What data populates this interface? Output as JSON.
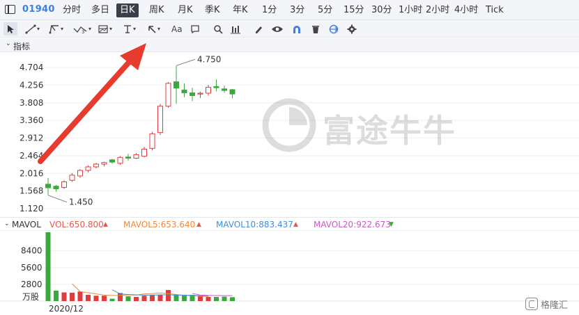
{
  "tabbar": {
    "code": "01940",
    "tabs": [
      "分时",
      "多日",
      "日K",
      "周K",
      "月K",
      "季K",
      "年K",
      "1分",
      "3分",
      "5分",
      "15分",
      "30分",
      "1小时",
      "2小时",
      "4小时",
      "Tick"
    ],
    "active": "日K"
  },
  "toolbar": {
    "tools": [
      "cursor-icon",
      "line-tool-icon",
      "pitchfork-tool-icon",
      "wave-tool-icon",
      "fib-grid-icon",
      "price-range-icon",
      "arrow-tool-icon",
      "text-tool-icon",
      "note-tool-icon",
      "zoom-icon",
      "chart-add-icon",
      "pen-icon",
      "eye-icon",
      "magnet-icon",
      "trash-icon",
      "sync-icon",
      "settings-icon"
    ],
    "text_tool_label": "Aa"
  },
  "indicator": {
    "label": "指标"
  },
  "price_axis": {
    "ticks": [
      "4.704",
      "4.256",
      "3.808",
      "3.360",
      "2.912",
      "2.464",
      "2.016",
      "1.568",
      "1.120"
    ],
    "high_label": "4.750",
    "low_label": "1.450"
  },
  "volume": {
    "title": "MAVOL",
    "vol_label": "VOL:650.800",
    "vol_arrow": "▲",
    "mavol5_label": "MAVOL5:653.640",
    "mavol5_arrow": "▲",
    "mavol10_label": "MAVOL10:883.437",
    "mavol10_arrow": "▲",
    "mavol20_label": "MAVOL20:922.673",
    "mavol20_arrow": "▼",
    "ticks": [
      "8400",
      "5600",
      "2800"
    ],
    "unit": "万股",
    "date_label": "2020/12"
  },
  "colors": {
    "up": "#e03c3c",
    "down": "#3aa83a",
    "accent": "#3f7fe0",
    "vol": "#e05a4a",
    "mavol5": "#f0883a",
    "mavol10": "#3c8fe0",
    "mavol20": "#cc55cc",
    "annotation_arrow": "#e63b2e"
  },
  "chart_data": {
    "type": "candlestick",
    "ylim": [
      1.12,
      4.75
    ],
    "candles": [
      {
        "o": 1.74,
        "c": 1.65,
        "h": 1.9,
        "l": 1.46
      },
      {
        "o": 1.69,
        "c": 1.62,
        "h": 1.72,
        "l": 1.55
      },
      {
        "o": 1.66,
        "c": 1.8,
        "h": 1.84,
        "l": 1.62
      },
      {
        "o": 1.84,
        "c": 1.97,
        "h": 2.02,
        "l": 1.8
      },
      {
        "o": 1.95,
        "c": 2.09,
        "h": 2.12,
        "l": 1.9
      },
      {
        "o": 2.09,
        "c": 2.18,
        "h": 2.22,
        "l": 2.04
      },
      {
        "o": 2.18,
        "c": 2.25,
        "h": 2.28,
        "l": 2.14
      },
      {
        "o": 2.25,
        "c": 2.29,
        "h": 2.31,
        "l": 2.19
      },
      {
        "o": 2.36,
        "c": 2.3,
        "h": 2.38,
        "l": 2.26
      },
      {
        "o": 2.27,
        "c": 2.42,
        "h": 2.45,
        "l": 2.23
      },
      {
        "o": 2.43,
        "c": 2.4,
        "h": 2.51,
        "l": 2.34
      },
      {
        "o": 2.4,
        "c": 2.49,
        "h": 2.53,
        "l": 2.38
      },
      {
        "o": 2.45,
        "c": 2.63,
        "h": 2.69,
        "l": 2.42
      },
      {
        "o": 2.65,
        "c": 3.02,
        "h": 3.07,
        "l": 2.6
      },
      {
        "o": 3.05,
        "c": 3.72,
        "h": 3.78,
        "l": 2.99
      },
      {
        "o": 3.72,
        "c": 4.3,
        "h": 4.33,
        "l": 3.68
      },
      {
        "o": 4.34,
        "c": 4.18,
        "h": 4.75,
        "l": 3.78
      },
      {
        "o": 4.13,
        "c": 4.06,
        "h": 4.3,
        "l": 3.95
      },
      {
        "o": 4.06,
        "c": 3.99,
        "h": 4.19,
        "l": 3.85
      },
      {
        "o": 4.03,
        "c": 4.05,
        "h": 4.09,
        "l": 3.93
      },
      {
        "o": 4.05,
        "c": 4.2,
        "h": 4.26,
        "l": 3.99
      },
      {
        "o": 4.22,
        "c": 4.19,
        "h": 4.4,
        "l": 4.1
      },
      {
        "o": 4.16,
        "c": 4.12,
        "h": 4.24,
        "l": 4.06
      },
      {
        "o": 4.14,
        "c": 4.03,
        "h": 4.16,
        "l": 3.92
      }
    ],
    "volumes": [
      11500,
      1750,
      1450,
      1400,
      1600,
      1050,
      900,
      900,
      400,
      1350,
      800,
      700,
      900,
      1050,
      1000,
      1850,
      1100,
      950,
      1050,
      800,
      700,
      700,
      750,
      650
    ],
    "vol_ylim": [
      0,
      11500
    ],
    "mavol": [
      {
        "name": "MAVOL5",
        "start": 3,
        "values": [
          2900,
          1600,
          1400,
          1200,
          1000,
          940,
          960,
          1050,
          1000,
          1200,
          1250,
          1350,
          1250,
          1100,
          950,
          900,
          820,
          780
        ]
      },
      {
        "name": "MAVOL10",
        "start": 8,
        "values": [
          1900,
          1200,
          1100,
          1050,
          1000,
          1000,
          1050,
          1050,
          1000,
          1000,
          950,
          900,
          880
        ]
      },
      {
        "name": "MAVOL20",
        "start": 18,
        "values": [
          1300,
          1000,
          950,
          925,
          920,
          922
        ]
      }
    ]
  }
}
